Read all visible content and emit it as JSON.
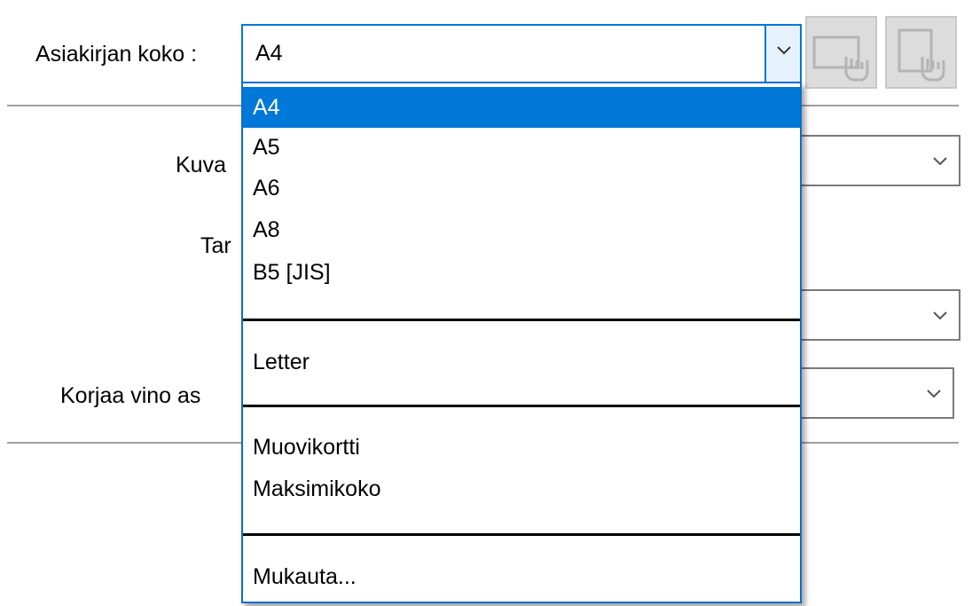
{
  "document_size": {
    "label": "Asiakirjan koko :",
    "selected": "A4",
    "options": [
      {
        "label": "A4",
        "selected": true
      },
      {
        "label": "A5",
        "selected": false
      },
      {
        "label": "A6",
        "selected": false
      },
      {
        "label": "A8",
        "selected": false
      },
      {
        "label": "B5 [JIS]",
        "selected": false
      },
      {
        "label": "Letter",
        "selected": false
      },
      {
        "label": "Muovikortti",
        "selected": false
      },
      {
        "label": "Maksimikoko",
        "selected": false
      },
      {
        "label": "Mukauta...",
        "selected": false
      }
    ]
  },
  "background_labels": {
    "kuva": "Kuva",
    "tar": "Tar",
    "korjaa": "Korjaa vino as"
  },
  "icons": {
    "dropdown_arrow": "chevron-down-icon",
    "toolbar_left": "landscape-page-hand-icon",
    "toolbar_right": "portrait-page-hand-icon"
  },
  "colors": {
    "selection": "#0078d7",
    "focus_border": "#0078d7",
    "disabled_button": "#dcdcdc"
  }
}
